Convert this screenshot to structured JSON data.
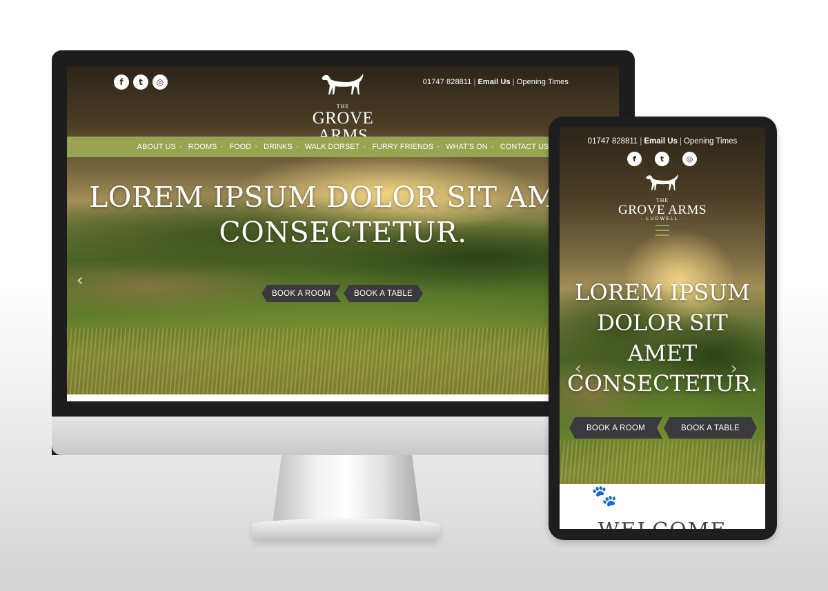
{
  "brand": {
    "the": "THE",
    "name": "GROVE ARMS",
    "location": "· LUDWELL ·"
  },
  "contact": {
    "phone": "01747 828811",
    "email": "Email Us",
    "opening": "Opening Times"
  },
  "social": [
    {
      "icon": "facebook-icon",
      "glyph": "f"
    },
    {
      "icon": "twitter-icon",
      "glyph": "t"
    },
    {
      "icon": "instagram-icon",
      "glyph": "◎"
    }
  ],
  "nav": [
    "ABOUT US",
    "ROOMS",
    "FOOD",
    "DRINKS",
    "WALK DORSET",
    "FURRY FRIENDS",
    "WHAT'S ON",
    "CONTACT US"
  ],
  "hero": {
    "desktop_line1": "LOREM IPSUM DOLOR SIT AMET",
    "desktop_line2": "CONSECTETUR.",
    "mobile_lines": [
      "LOREM IPSUM",
      "DOLOR SIT",
      "AMET",
      "CONSECTETUR."
    ]
  },
  "buttons": {
    "book_room": "BOOK A ROOM",
    "book_table": "BOOK A TABLE"
  },
  "welcome": "WELCOME",
  "colors": {
    "accent_green": "#98a452",
    "button_dark": "#3a3a3e",
    "device_bezel": "#1d1d1d"
  }
}
